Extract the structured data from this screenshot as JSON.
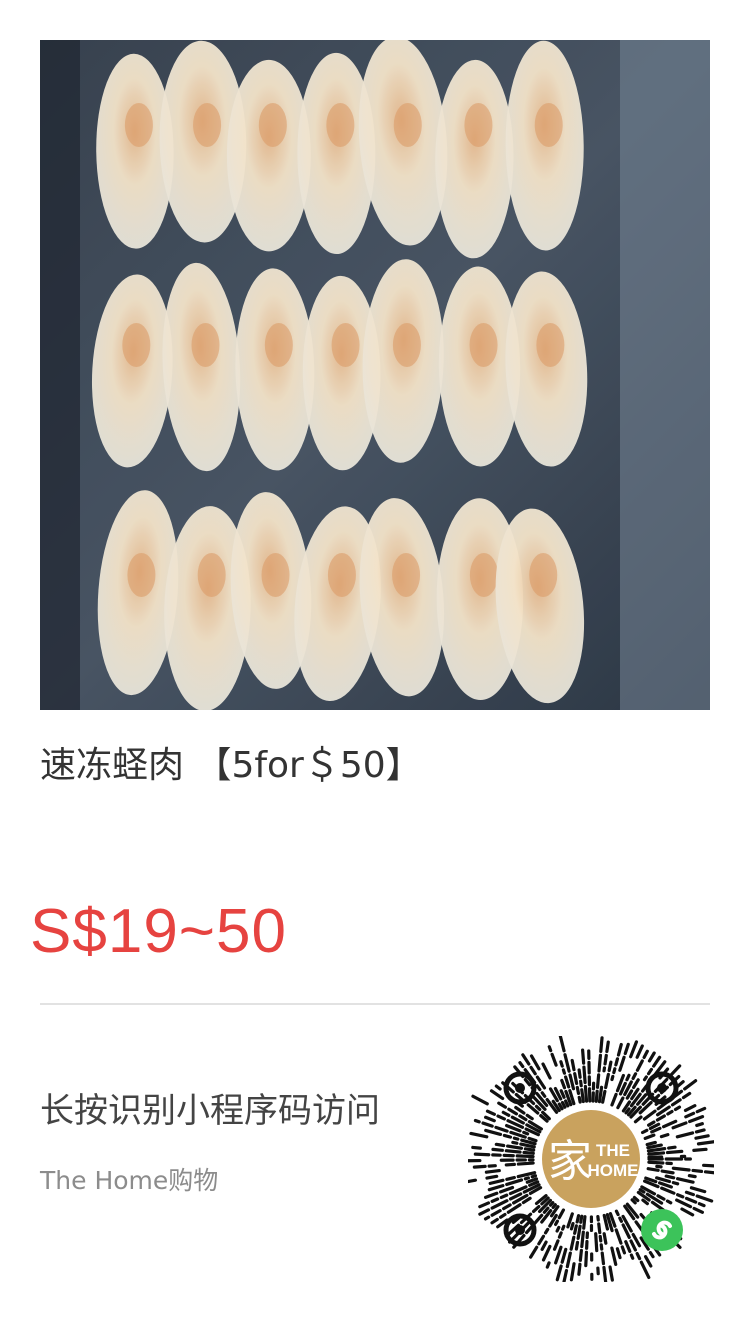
{
  "product": {
    "title": "速冻蛏肉 【5for＄50】",
    "price": "S$19~50",
    "image_icon": "frozen-razor-clam-photo"
  },
  "share": {
    "caption": "长按识别小程序码访问",
    "shop_name": "The Home购物",
    "qr_logo_text_line1": "THE",
    "qr_logo_text_line2": "HOME",
    "qr_logo_glyph": "家"
  },
  "colors": {
    "price": "#e64340",
    "qr_logo_gold": "#c9a25e",
    "mini_program_green": "#3cc35a"
  }
}
